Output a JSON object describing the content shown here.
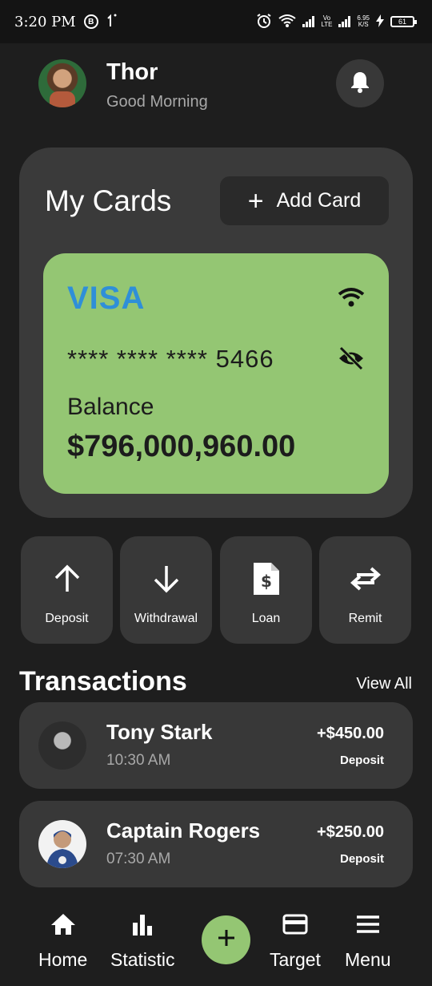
{
  "status_bar": {
    "time": "3:20 PM",
    "b_icon": "B",
    "net_rate_top": "6.95",
    "net_rate_bottom": "K/S",
    "vo_top": "Vo",
    "vo_bottom": "LTE",
    "battery": "61"
  },
  "header": {
    "name": "Thor",
    "greeting": "Good Morning"
  },
  "cards": {
    "title": "My Cards",
    "add_card_label": "Add Card",
    "card": {
      "brand": "VISA",
      "number": "**** **** **** 5466",
      "balance_label": "Balance",
      "balance_value": "$796,000,960.00"
    }
  },
  "actions": [
    {
      "label": "Deposit",
      "icon": "arrow-up-icon"
    },
    {
      "label": "Withdrawal",
      "icon": "arrow-down-icon"
    },
    {
      "label": "Loan",
      "icon": "document-dollar-icon"
    },
    {
      "label": "Remit",
      "icon": "swap-arrows-icon"
    }
  ],
  "transactions": {
    "title": "Transactions",
    "view_all": "View All",
    "items": [
      {
        "name": "Tony Stark",
        "time": "10:30 AM",
        "amount": "+$450.00",
        "type": "Deposit"
      },
      {
        "name": "Captain Rogers",
        "time": "07:30 AM",
        "amount": "+$250.00",
        "type": "Deposit"
      }
    ]
  },
  "nav": {
    "items": [
      {
        "label": "Home",
        "icon": "home-icon"
      },
      {
        "label": "Statistic",
        "icon": "bar-chart-icon"
      },
      {
        "label": "Target",
        "icon": "credit-card-icon"
      },
      {
        "label": "Menu",
        "icon": "hamburger-menu-icon"
      }
    ]
  },
  "colors": {
    "background": "#1e1e1e",
    "panel": "#3a3a3a",
    "card": "#94c673",
    "visa_blue": "#2f8fd8"
  }
}
